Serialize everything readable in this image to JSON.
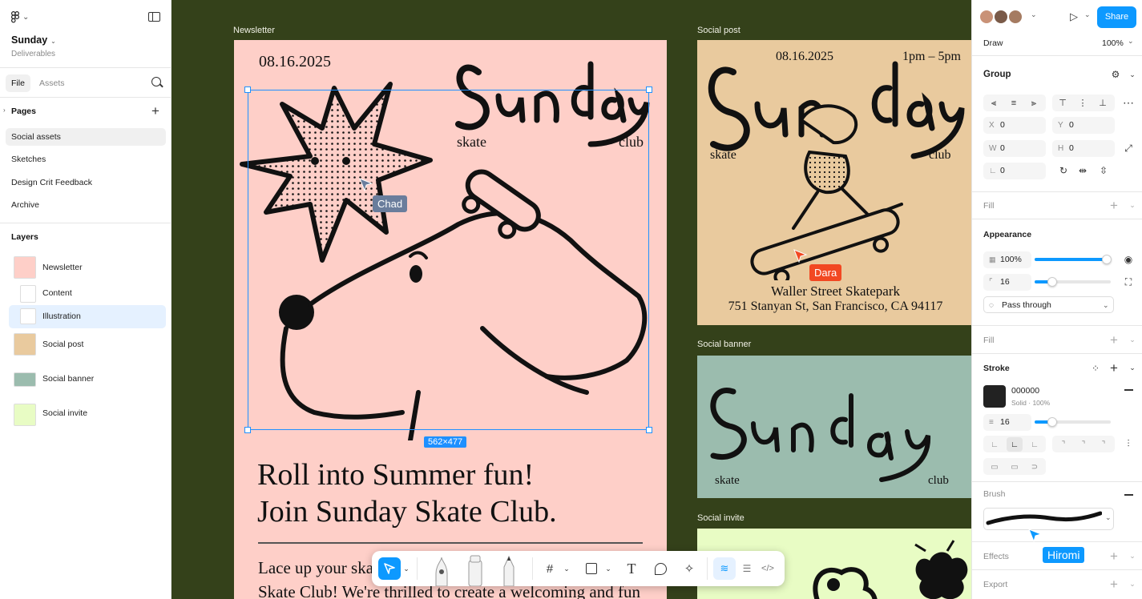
{
  "project": {
    "name": "Sunday",
    "subtitle": "Deliverables"
  },
  "left_tabs": {
    "file": "File",
    "assets": "Assets"
  },
  "pages": {
    "heading": "Pages",
    "items": [
      "Social assets",
      "Sketches",
      "Design Crit Feedback",
      "Archive"
    ],
    "active": "Social assets"
  },
  "layers": {
    "heading": "Layers",
    "items": [
      {
        "label": "Newsletter",
        "thumb": "#fecfc8"
      },
      {
        "label": "Content",
        "thumb": "#ffffff"
      },
      {
        "label": "Illustration",
        "thumb": "#ffffff"
      },
      {
        "label": "Social post",
        "thumb": "#e9ca9e"
      },
      {
        "label": "Social banner",
        "thumb": "#9bbcae"
      },
      {
        "label": "Social invite",
        "thumb": "#e8fcc4"
      }
    ],
    "selected": "Illustration"
  },
  "canvas": {
    "frames": {
      "newsletter": "Newsletter",
      "social_post": "Social post",
      "social_banner": "Social banner",
      "social_invite": "Social invite"
    },
    "newsletter": {
      "date": "08.16.2025",
      "word_skate": "skate",
      "word_club": "club",
      "heading_line1": "Roll into Summer fun!",
      "heading_line2": "Join Sunday Skate Club.",
      "body_line1": "Lace up your skat",
      "body_line2": "Skate Club! We're thrilled to create a welcoming and fun"
    },
    "social_post": {
      "date": "08.16.2025",
      "time": "1pm – 5pm",
      "word_skate": "skate",
      "word_club": "club",
      "venue": "Waller Street Skatepark",
      "address": "751 Stanyan St, San Francisco, CA 94117"
    },
    "social_banner": {
      "word_skate": "skate",
      "word_club": "club"
    },
    "selection_size": "562×477",
    "cursors": {
      "chad": {
        "name": "Chad",
        "color": "#6a7d9c"
      },
      "dara": {
        "name": "Dara",
        "color": "#f24822"
      },
      "hiromi": {
        "name": "Hiromi",
        "color": "#0d99ff"
      }
    }
  },
  "right": {
    "share": "Share",
    "mode": {
      "label": "Draw",
      "zoom": "100%"
    },
    "group": {
      "title": "Group",
      "x_label": "X",
      "x": "0",
      "y_label": "Y",
      "y": "0",
      "w_label": "W",
      "w": "0",
      "h_label": "H",
      "h": "0",
      "rotation": "0"
    },
    "fill1": "Fill",
    "appearance": {
      "title": "Appearance",
      "opacity": "100%",
      "radius": "16",
      "blend": "Pass through"
    },
    "fill2": "Fill",
    "stroke": {
      "title": "Stroke",
      "color_hex": "000000",
      "style": "Solid · 100%",
      "weight": "16"
    },
    "brush": "Brush",
    "effects": "Effects",
    "export": "Export"
  },
  "colors": {
    "accent": "#0d99ff",
    "canvas": "#34411a"
  }
}
